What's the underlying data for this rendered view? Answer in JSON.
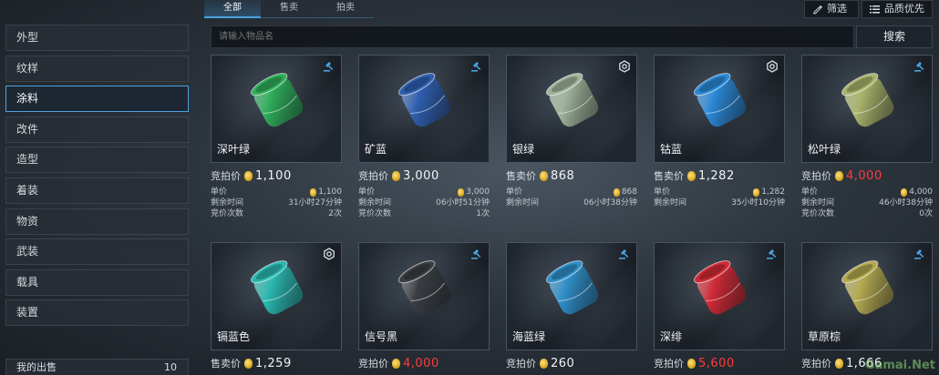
{
  "tabs": [
    {
      "label": "全部"
    },
    {
      "label": "售卖"
    },
    {
      "label": "拍卖"
    }
  ],
  "toolbar": {
    "filter_label": "筛选",
    "sort_label": "品质优先"
  },
  "search": {
    "placeholder": "请输入物品名",
    "button_label": "搜索"
  },
  "sidebar": {
    "items": [
      {
        "label": "外型"
      },
      {
        "label": "纹样"
      },
      {
        "label": "涂料"
      },
      {
        "label": "改件"
      },
      {
        "label": "造型"
      },
      {
        "label": "着装"
      },
      {
        "label": "物资"
      },
      {
        "label": "武装"
      },
      {
        "label": "载具"
      },
      {
        "label": "装置"
      }
    ],
    "active": "涂料",
    "my_sale": {
      "label": "我的出售",
      "count": "10"
    }
  },
  "labels": {
    "unit_price": "单价",
    "time_left": "剩余时间",
    "bid_count": "竞价次数"
  },
  "cards": [
    {
      "name": "深叶绿",
      "price_label": "竞拍价",
      "price": "1,100",
      "price_red": false,
      "badge": "auction-icon",
      "color": "#2fae5a",
      "unit_price": "1,100",
      "time_left": "31小时27分钟",
      "bids": "2次"
    },
    {
      "name": "矿蓝",
      "price_label": "竞拍价",
      "price": "3,000",
      "price_red": false,
      "badge": "auction-icon",
      "color": "#2f5fb0",
      "unit_price": "3,000",
      "time_left": "06小时51分钟",
      "bids": "1次"
    },
    {
      "name": "银绿",
      "price_label": "售卖价",
      "price": "868",
      "price_red": false,
      "badge": "sell-icon",
      "color": "#9fb39a",
      "unit_price": "868",
      "time_left": "06小时38分钟",
      "bids": ""
    },
    {
      "name": "钴蓝",
      "price_label": "售卖价",
      "price": "1,282",
      "price_red": false,
      "badge": "sell-icon",
      "color": "#2a88d6",
      "unit_price": "1,282",
      "time_left": "35小时10分钟",
      "bids": ""
    },
    {
      "name": "松叶绿",
      "price_label": "竞拍价",
      "price": "4,000",
      "price_red": true,
      "badge": "auction-icon",
      "color": "#a9b36a",
      "unit_price": "4,000",
      "time_left": "46小时38分钟",
      "bids": "0次"
    },
    {
      "name": "镉蓝色",
      "price_label": "售卖价",
      "price": "1,259",
      "price_red": false,
      "badge": "sell-icon",
      "color": "#2ab8b0"
    },
    {
      "name": "信号黑",
      "price_label": "竞拍价",
      "price": "4,000",
      "price_red": true,
      "badge": "auction-icon",
      "color": "#3a3d42"
    },
    {
      "name": "海蓝绿",
      "price_label": "竞拍价",
      "price": "260",
      "price_red": false,
      "badge": "auction-icon",
      "color": "#2f8fc8"
    },
    {
      "name": "深绯",
      "price_label": "竞拍价",
      "price": "5,600",
      "price_red": true,
      "badge": "auction-icon",
      "color": "#d02a36"
    },
    {
      "name": "草原棕",
      "price_label": "竞拍价",
      "price": "1,666",
      "price_red": false,
      "badge": "auction-icon",
      "color": "#b3a950"
    }
  ],
  "watermark": "Gamai.Net"
}
